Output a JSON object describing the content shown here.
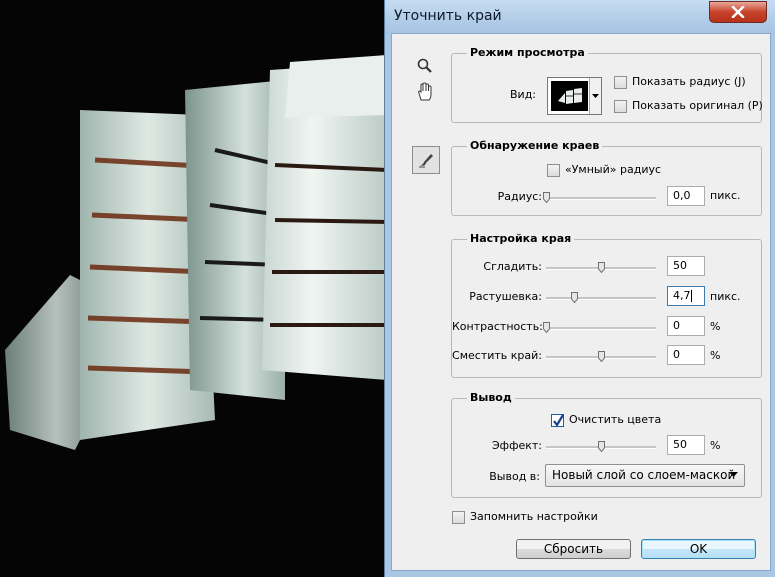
{
  "window": {
    "title": "Уточнить край",
    "close_icon": "close-icon"
  },
  "tools": [
    "zoom-icon",
    "hand-icon",
    "refine-radius-brush-icon"
  ],
  "view_mode": {
    "legend": "Режим просмотра",
    "view_label": "Вид:",
    "show_radius": {
      "label": "Показать радиус (J)",
      "checked": false
    },
    "show_original": {
      "label": "Показать оригинал (P)",
      "checked": false
    }
  },
  "edge_detection": {
    "legend": "Обнаружение краев",
    "smart_radius": {
      "label": "«Умный» радиус",
      "checked": false
    },
    "radius": {
      "label": "Радиус:",
      "value": "0,0",
      "unit": "пикс.",
      "level": 0.0
    }
  },
  "adjust_edge": {
    "legend": "Настройка края",
    "smooth": {
      "label": "Сгладить:",
      "value": "50",
      "unit": "",
      "level": 0.5
    },
    "feather": {
      "label": "Растушевка:",
      "value": "4,7",
      "unit": "пикс.",
      "level": 0.25
    },
    "contrast": {
      "label": "Контрастность:",
      "value": "0",
      "unit": "%",
      "level": 0.0
    },
    "shift_edge": {
      "label": "Сместить край:",
      "value": "0",
      "unit": "%",
      "level": 0.5
    }
  },
  "output": {
    "legend": "Вывод",
    "decontaminate": {
      "label": "Очистить цвета",
      "checked": true
    },
    "amount": {
      "label": "Эффект:",
      "value": "50",
      "unit": "%",
      "level": 0.5
    },
    "output_to": {
      "label": "Вывод в:",
      "selected": "Новый слой со слоем-маской"
    }
  },
  "remember": {
    "label": "Запомнить настройки",
    "checked": false
  },
  "buttons": {
    "reset": "Сбросить",
    "ok": "OK"
  },
  "colors": {
    "title_bar": "#a9c6e3",
    "close_button": "#c7432b",
    "client": "#efefef"
  }
}
